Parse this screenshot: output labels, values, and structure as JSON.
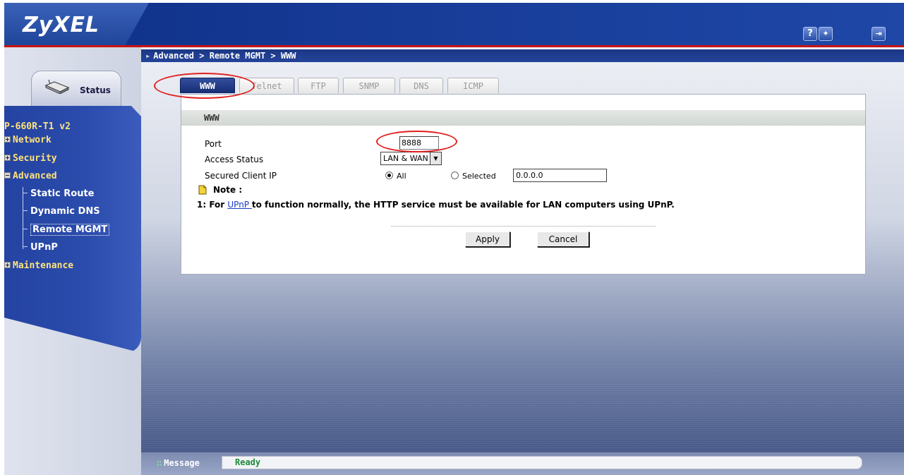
{
  "header": {
    "logo": "ZyXEL",
    "help_icon": "?",
    "wizard_icon": "wizard-icon",
    "logout_icon": "logout-icon"
  },
  "breadcrumb": "Advanced > Remote MGMT > WWW",
  "nav": {
    "status_label": "Status",
    "model": "P-660R-T1 v2",
    "items": [
      {
        "label": "Network",
        "state": "collapsed"
      },
      {
        "label": "Security",
        "state": "collapsed"
      },
      {
        "label": "Advanced",
        "state": "expanded"
      },
      {
        "label": "Maintenance",
        "state": "collapsed"
      }
    ],
    "advanced_sub": [
      {
        "label": "Static Route"
      },
      {
        "label": "Dynamic DNS"
      },
      {
        "label": "Remote MGMT",
        "active": true
      },
      {
        "label": "UPnP"
      }
    ]
  },
  "tabs": [
    {
      "label": "WWW",
      "active": true
    },
    {
      "label": "Telnet"
    },
    {
      "label": "FTP"
    },
    {
      "label": "SNMP"
    },
    {
      "label": "DNS"
    },
    {
      "label": "ICMP"
    }
  ],
  "panel": {
    "title": "WWW",
    "port_label": "Port",
    "port_value": "8888",
    "access_label": "Access Status",
    "access_value": "LAN & WAN",
    "client_ip_label": "Secured Client IP",
    "radio_all": "All",
    "radio_selected": "Selected",
    "ip_value": "0.0.0.0",
    "note_label": "Note :",
    "note_prefix": "1: For ",
    "note_link": "UPnP ",
    "note_suffix": " to function normally, the HTTP service must be available for LAN computers using UPnP.",
    "apply": "Apply",
    "cancel": "Cancel"
  },
  "message": {
    "label": "Message",
    "value": "Ready"
  },
  "colors": {
    "header_blue": "#173c98",
    "accent_red": "#c81414",
    "nav_yellow": "#ffe27a",
    "ready_green": "#1f8a3a"
  }
}
